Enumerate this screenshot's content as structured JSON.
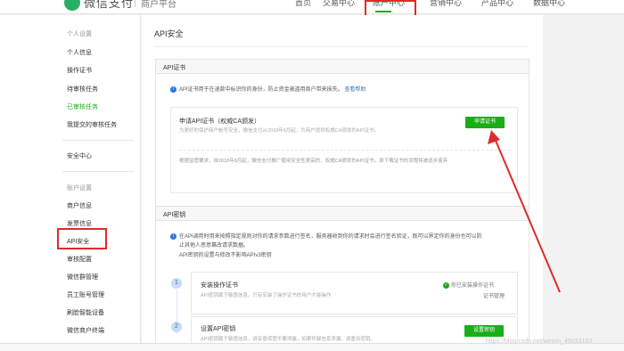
{
  "topbar": {
    "logo_text": "微信支付",
    "sub_title": "商户平台",
    "nav": [
      "首页",
      "交易中心",
      "账户中心",
      "营销中心",
      "产品中心",
      "数据中心"
    ]
  },
  "sidebar": {
    "group_personal": "个人设置",
    "items_personal": [
      "个人信息",
      "操作证书",
      "待审核任务",
      "已审核任务",
      "我提交的审核任务"
    ],
    "security_center": "安全中心",
    "group_account": "账户设置",
    "items_account": [
      "商户信息",
      "发票信息",
      "API安全",
      "审核配置",
      "微信群管理",
      "员工账号管理",
      "刷脸智能设备",
      "微信商户终端"
    ]
  },
  "main": {
    "title": "API安全",
    "cert_card": {
      "header": "API证书",
      "info": "API证书用于在退款中标识你的身份，防止资金被盗用商户带来损失。",
      "info_link": "查看帮助",
      "apply_title": "申请API证书（权威CA颁发）",
      "apply_desc": "为更好的保护商户帐号安全，微信支付从2018年6月起，为商户提供权威CA颁发的API证书。",
      "apply_button": "申请证书",
      "notice": "根据监管要求，自2018年8月起，微信支付推广使用安全性更高的、权威CA颁发的API证书，原下载证书的流程将被逐步废弃"
    },
    "key_card": {
      "header": "API密钥",
      "info_line1": "在API调用时用来按照指定规则对你的请求参数进行签名，服务器收到你的请求时会进行签名验证，既可以界定你的身份也可以防",
      "info_line2": "止其他人恶意篡改请求数据。",
      "info_line3": "API密钥的设置与修改不影响APIv3密钥",
      "step1": {
        "num": "1",
        "title": "安装操作证书",
        "desc": "API密钥属于敏感信息，只有安装了操作证书的用户才能操作",
        "status": "你已安装操作证书",
        "link": "证书管理"
      },
      "step2": {
        "num": "2",
        "title": "设置API密钥",
        "desc": "API密钥属于敏感信息，请妥善保管不要泄露，如果怀疑信息泄漏，请重设密钥。",
        "button": "设置密钥"
      }
    }
  },
  "watermark": "https://blog.csdn.net/weixin_45033183"
}
